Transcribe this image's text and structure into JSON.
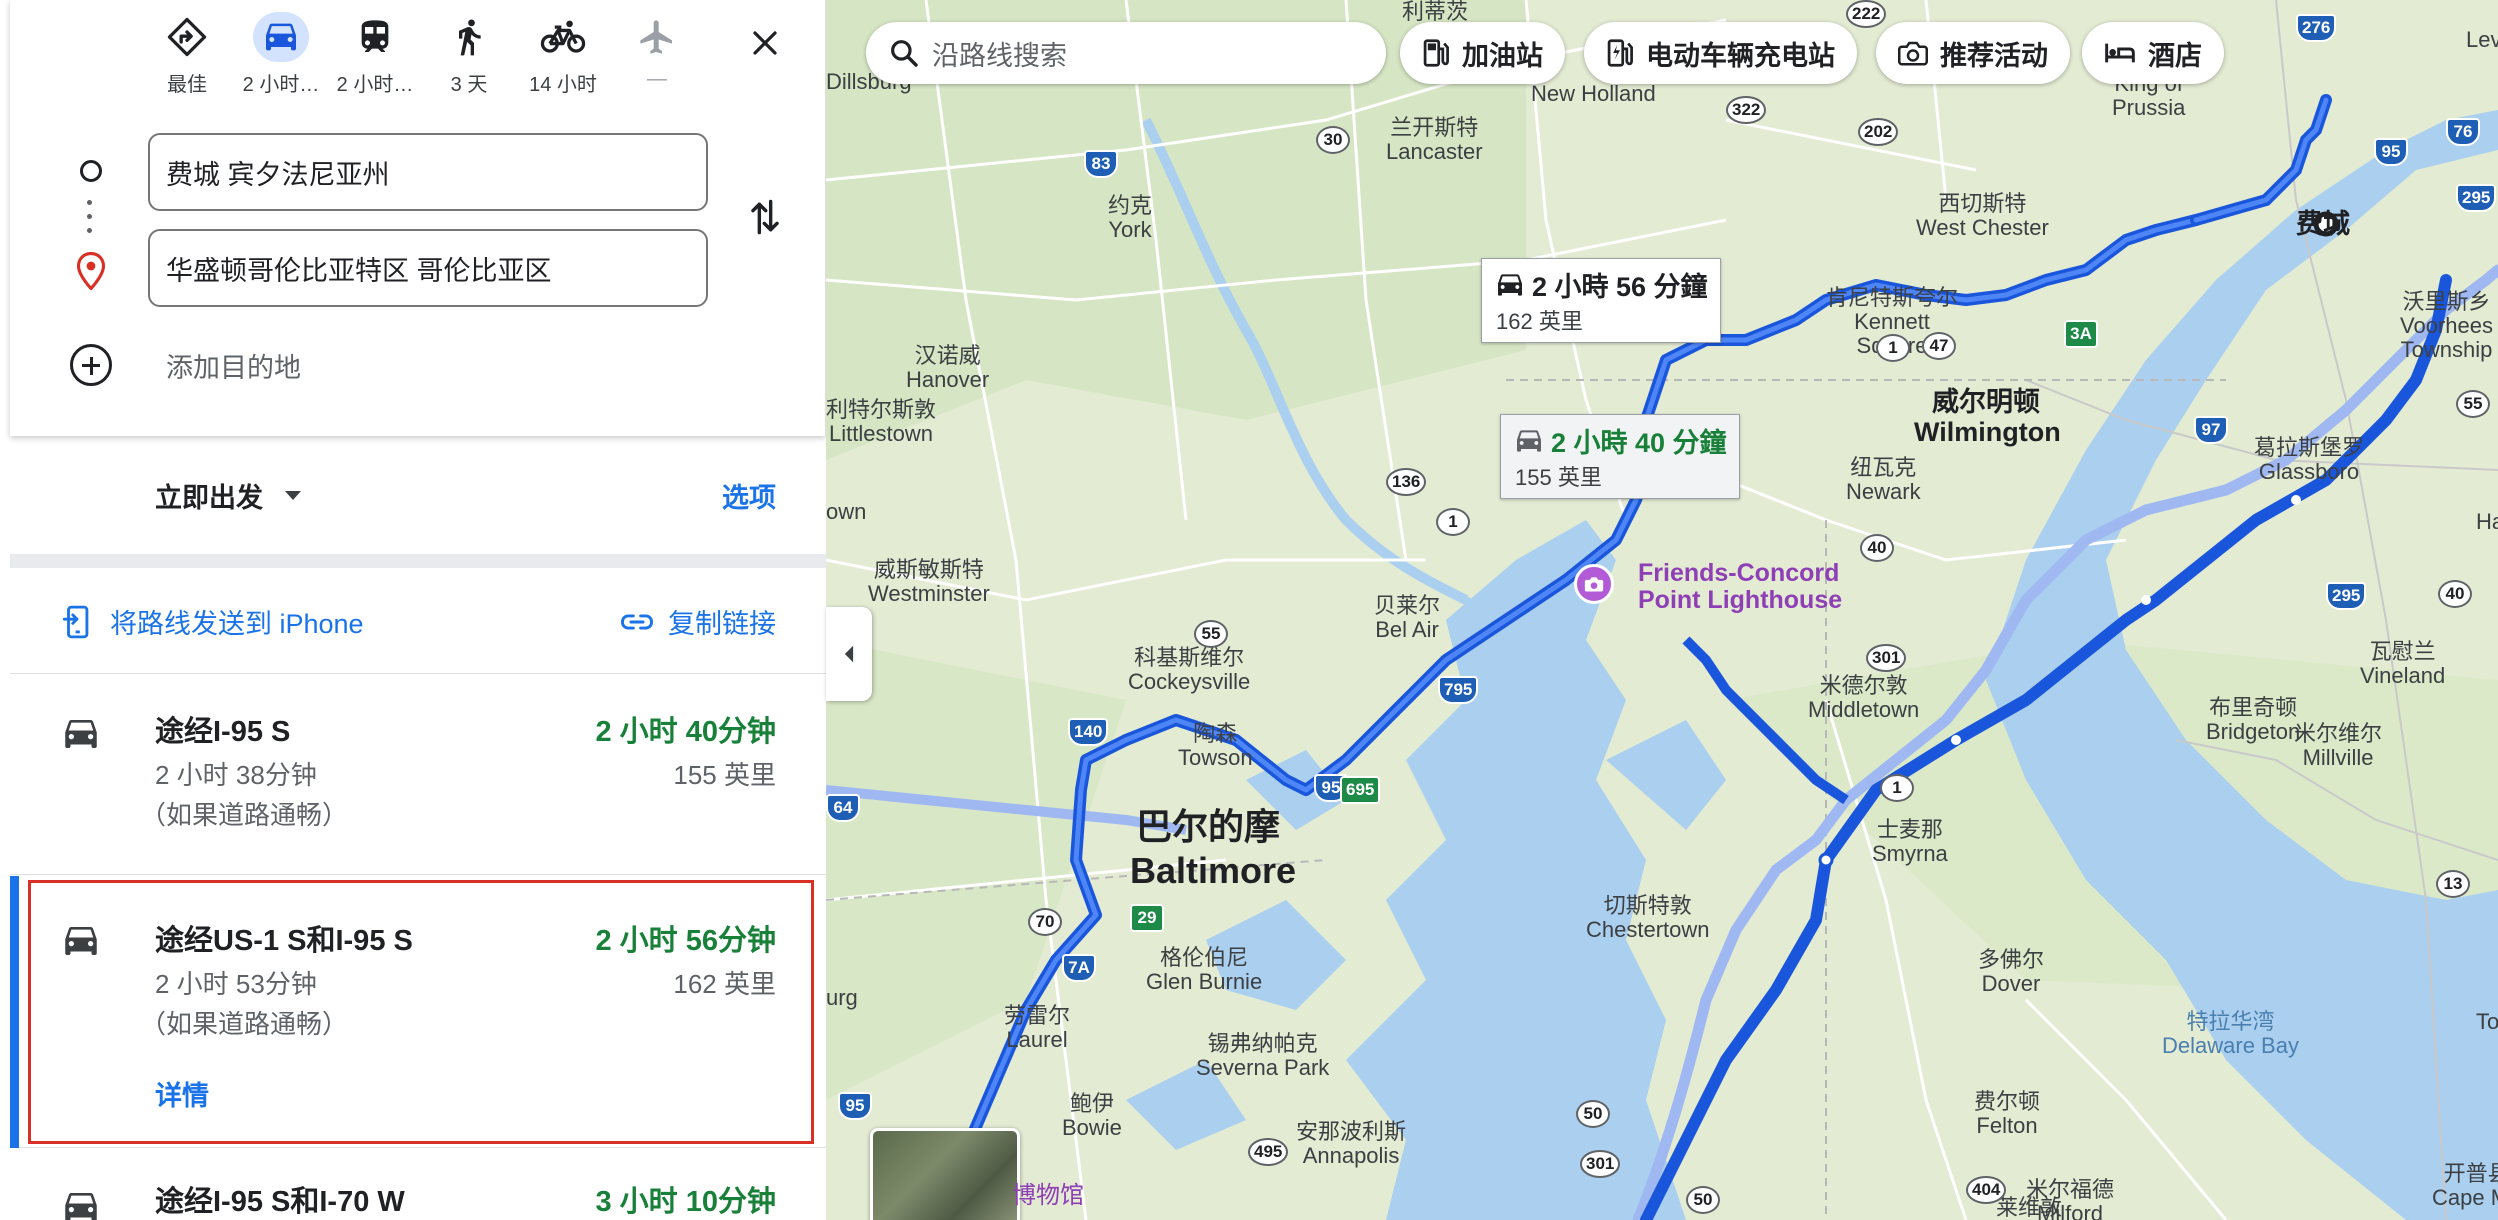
{
  "modes": [
    {
      "label": "最佳",
      "icon": "diamond-arrow-icon",
      "selected": false
    },
    {
      "label": "2 小时…",
      "icon": "car-icon",
      "selected": true
    },
    {
      "label": "2 小时…",
      "icon": "train-icon",
      "selected": false
    },
    {
      "label": "3 天",
      "icon": "walk-icon",
      "selected": false
    },
    {
      "label": "14 小时",
      "icon": "bike-icon",
      "selected": false
    },
    {
      "label": "—",
      "icon": "plane-icon",
      "selected": false
    }
  ],
  "directions": {
    "origin": "费城 宾夕法尼亚州",
    "destination": "华盛顿哥伦比亚特区 哥伦比亚区",
    "add_destination": "添加目的地"
  },
  "depart": {
    "label": "立即出发",
    "options": "选项"
  },
  "share": {
    "send_to_phone": "将路线发送到 iPhone",
    "copy_link": "复制链接"
  },
  "routes": [
    {
      "name": "途经I-95 S",
      "time": "2 小时 40分钟",
      "typical": "2 小时 38分钟",
      "distance": "155 英里",
      "note": "（如果道路通畅）"
    },
    {
      "name": "途经US-1 S和I-95 S",
      "time": "2 小时 56分钟",
      "typical": "2 小时 53分钟",
      "distance": "162 英里",
      "note": "（如果道路通畅）",
      "details": "详情",
      "highlighted": true
    },
    {
      "name": "途经I-95 S和I-70 W",
      "time": "3 小时 10分钟"
    }
  ],
  "map": {
    "search_placeholder": "沿路线搜索",
    "chips": [
      "加油站",
      "电动车辆充电站",
      "推荐活动",
      "酒店"
    ],
    "bubble_selected": {
      "time": "2 小時 56 分鐘",
      "distance": "162 英里"
    },
    "bubble_alt": {
      "time": "2 小時 40 分鐘",
      "distance": "155 英里"
    },
    "poi": "Friends-Concord\nPoint Lighthouse",
    "museum_label": "博物馆",
    "labels": {
      "philly": "费城",
      "baltimore_cn": "巴尔的摩",
      "baltimore_en": "Baltimore",
      "wilmington_cn": "威尔明顿",
      "wilmington_en": "Wilmington",
      "new_holland": "New Holland",
      "lancaster": "兰开斯特\nLancaster",
      "york": "约克\nYork",
      "hanover": "汉诺威\nHanover",
      "littlestown": "利特尔斯敦\nLittlestown",
      "westminster": "威斯敏斯特\nWestminster",
      "cockeysville": "科基斯维尔\nCockeysville",
      "towson": "陶森\nTowson",
      "belair": "贝莱尔\nBel Air",
      "glenburnie": "格伦伯尼\nGlen Burnie",
      "laurel": "劳雷尔\nLaurel",
      "bowie": "鲍伊\nBowie",
      "severnapark": "锡弗纳帕克\nSeverna Park",
      "annapolis": "安那波利斯\nAnnapolis",
      "westchester": "西切斯特\nWest Chester",
      "kennett": "肯尼特斯夸尔\nKennett\nSquare",
      "newark": "纽瓦克\nNewark",
      "middletown": "米德尔敦\nMiddletown",
      "smyrna": "士麦那\nSmyrna",
      "chestertown": "切斯特敦\nChestertown",
      "dover": "多佛尔\nDover",
      "felton": "费尔顿\nFelton",
      "milford": "米尔福德\nMilford",
      "bridgeton": "布里奇顿\nBridgeton",
      "millville": "米尔维尔\nMillville",
      "vineland": "瓦慰兰\nVineland",
      "glassboro": "葛拉斯堡罗\nGlassboro",
      "voorhees": "沃里斯乡\nVoorhees\nTownship",
      "kingprussia": "King of\nPrussia",
      "delawarebay": "特拉华湾\nDelaware Bay",
      "capemay": "开普县\nCape Ma",
      "town_top": "利蒂茨",
      "dillsburg": "Dillsburg",
      "lev": "Lev",
      "own": "own",
      "urg": "urg",
      "town_e": "To",
      "town_h": "Ha",
      "town_levittown": "莱维敦"
    },
    "shields": [
      "276",
      "76",
      "95",
      "295",
      "222",
      "322",
      "202",
      "30",
      "83",
      "1",
      "3A",
      "136",
      "97",
      "295",
      "40",
      "55",
      "140",
      "795",
      "95",
      "695",
      "64",
      "70",
      "29",
      "7A",
      "95",
      "495",
      "50",
      "301",
      "50",
      "404",
      "13",
      "47",
      "1",
      "301",
      "1",
      "40",
      "55"
    ]
  }
}
